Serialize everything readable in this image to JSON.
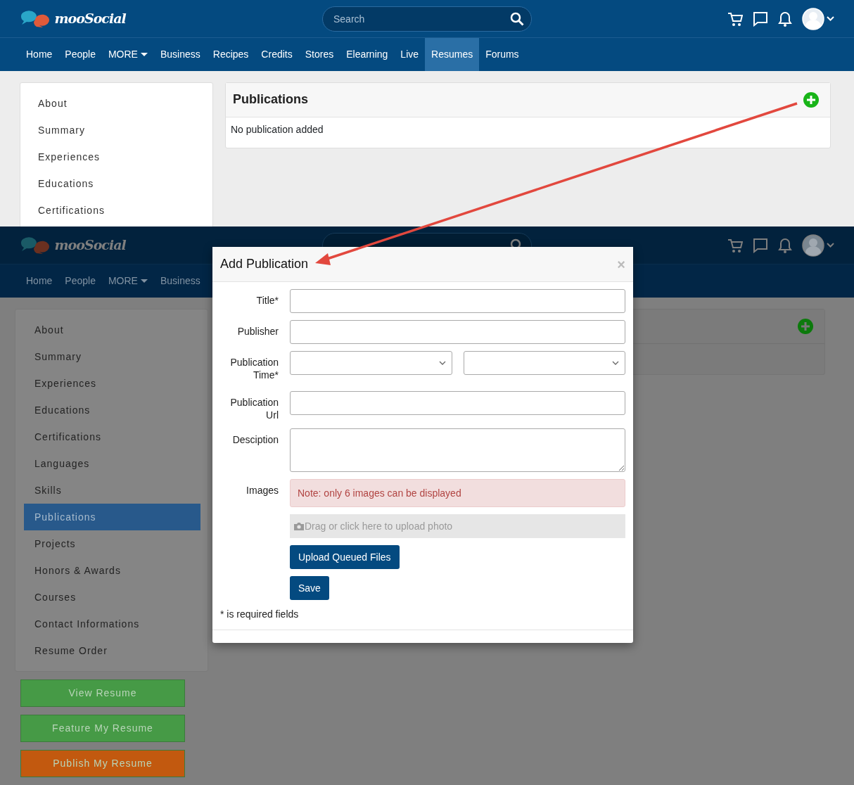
{
  "top_screen": {
    "header": {
      "logo": "mooSocial",
      "search": {
        "placeholder": "Search"
      }
    },
    "nav": [
      {
        "label": "Home",
        "selected": false,
        "dropdown": false
      },
      {
        "label": "People",
        "selected": false,
        "dropdown": false
      },
      {
        "label": "MORE",
        "selected": false,
        "dropdown": true
      },
      {
        "label": "Business",
        "selected": false,
        "dropdown": false
      },
      {
        "label": "Recipes",
        "selected": false,
        "dropdown": false
      },
      {
        "label": "Credits",
        "selected": false,
        "dropdown": false
      },
      {
        "label": "Stores",
        "selected": false,
        "dropdown": false
      },
      {
        "label": "Elearning",
        "selected": false,
        "dropdown": false
      },
      {
        "label": "Live",
        "selected": false,
        "dropdown": false
      },
      {
        "label": "Resumes",
        "selected": true,
        "dropdown": false
      },
      {
        "label": "Forums",
        "selected": false,
        "dropdown": false
      }
    ],
    "sidebar": [
      {
        "label": "About",
        "selected": false
      },
      {
        "label": "Summary",
        "selected": false
      },
      {
        "label": "Experiences",
        "selected": false
      },
      {
        "label": "Educations",
        "selected": false
      },
      {
        "label": "Certifications",
        "selected": false
      }
    ],
    "panel": {
      "title": "Publications",
      "empty_text": "No publication added"
    }
  },
  "bottom_screen": {
    "header": {
      "logo": "mooSocial"
    },
    "nav": [
      {
        "label": "Home",
        "selected": false,
        "dropdown": false
      },
      {
        "label": "People",
        "selected": false,
        "dropdown": false
      },
      {
        "label": "MORE",
        "selected": false,
        "dropdown": true
      },
      {
        "label": "Business",
        "selected": false,
        "dropdown": false
      }
    ],
    "sidebar": [
      {
        "label": "About",
        "selected": false
      },
      {
        "label": "Summary",
        "selected": false
      },
      {
        "label": "Experiences",
        "selected": false
      },
      {
        "label": "Educations",
        "selected": false
      },
      {
        "label": "Certifications",
        "selected": false
      },
      {
        "label": "Languages",
        "selected": false
      },
      {
        "label": "Skills",
        "selected": false
      },
      {
        "label": "Publications",
        "selected": true
      },
      {
        "label": "Projects",
        "selected": false
      },
      {
        "label": "Honors & Awards",
        "selected": false
      },
      {
        "label": "Courses",
        "selected": false
      },
      {
        "label": "Contact Informations",
        "selected": false
      },
      {
        "label": "Resume Order",
        "selected": false
      }
    ],
    "sidebar_buttons": [
      {
        "label": "View Resume",
        "color": "#469a46"
      },
      {
        "label": "Feature My Resume",
        "color": "#469a46"
      },
      {
        "label": "Publish My Resume",
        "color": "#c2590f"
      }
    ],
    "modal": {
      "title": "Add Publication",
      "close": "×",
      "fields": [
        {
          "label": "Title*",
          "kind": "text"
        },
        {
          "label": "Publisher",
          "kind": "text"
        },
        {
          "label": "Publication Time*",
          "kind": "selects"
        },
        {
          "label": "Publication Url",
          "kind": "text"
        },
        {
          "label": "Desciption",
          "kind": "textarea"
        },
        {
          "label": "Images",
          "kind": "images",
          "note": "Note: only 6 images can be displayed",
          "dropzone": "Drag or click here to upload photo"
        }
      ],
      "buttons": [
        "Upload Queued Files",
        "Save"
      ],
      "footnote": "* is required fields"
    }
  }
}
